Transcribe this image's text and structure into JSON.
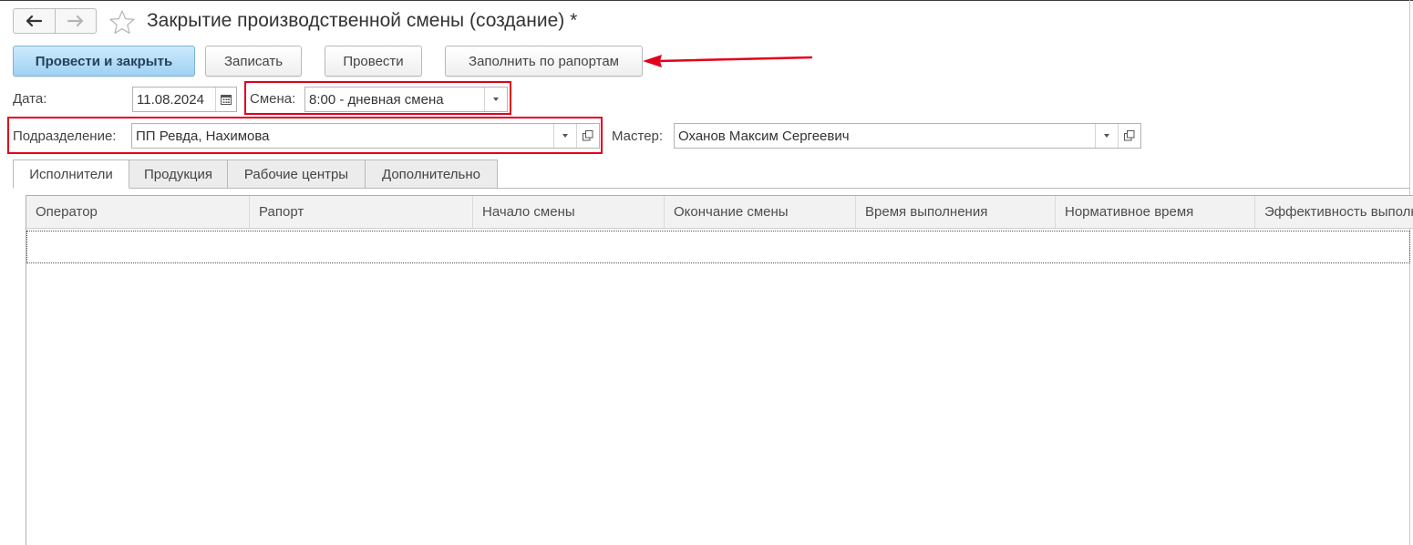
{
  "window": {
    "title": "Закрытие производственной смены (создание) *"
  },
  "nav": {
    "back_icon": "arrow-left-icon",
    "forward_icon": "arrow-right-icon",
    "favorite_icon": "star-icon"
  },
  "toolbar": {
    "post_close_label": "Провести и закрыть",
    "save_label": "Записать",
    "post_label": "Провести",
    "fill_label": "Заполнить по рапортам"
  },
  "form": {
    "date_label": "Дата:",
    "date_value": "11.08.2024",
    "shift_label": "Смена:",
    "shift_value": "8:00 - дневная смена",
    "division_label": "Подразделение:",
    "division_value": "ПП Ревда, Нахимова",
    "master_label": "Мастер:",
    "master_value": "Оханов Максим Сергеевич"
  },
  "tabs": [
    {
      "label": "Исполнители"
    },
    {
      "label": "Продукция"
    },
    {
      "label": "Рабочие центры"
    },
    {
      "label": "Дополнительно"
    }
  ],
  "table": {
    "columns": [
      "Оператор",
      "Рапорт",
      "Начало смены",
      "Окончание смены",
      "Время выполнения",
      "Нормативное время",
      "Эффективность выполнения"
    ]
  },
  "colors": {
    "highlight": "#e3001b",
    "primary_button": "#9fd1f3"
  }
}
